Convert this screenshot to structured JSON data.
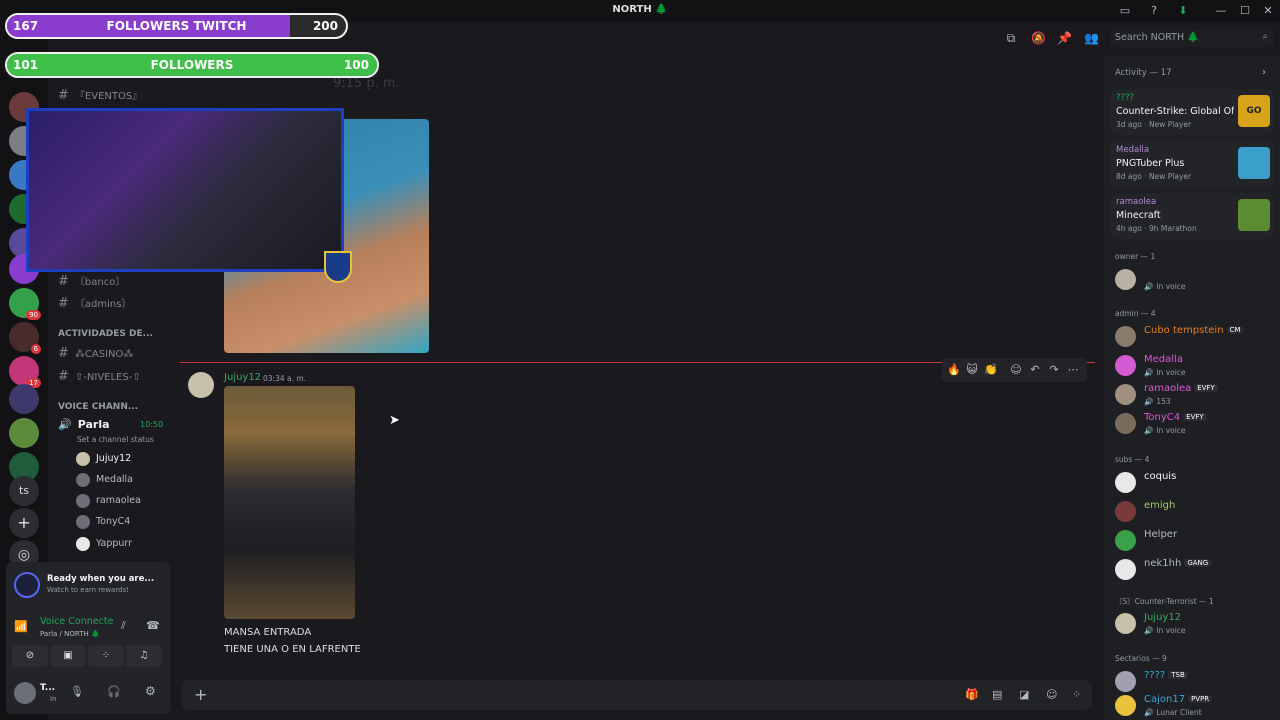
{
  "window": {
    "title": "NORTH 🌲",
    "buttons": [
      "▭",
      "?",
      "⬇",
      "—",
      "☐",
      "✕"
    ]
  },
  "overlay": {
    "twitch_bar": {
      "current": "167",
      "label": "FOLLOWERS TWITCH",
      "goal": "200",
      "progress": 0.835,
      "color": "#8a3ccf"
    },
    "followers_bar": {
      "current": "101",
      "label": "FOLLOWERS",
      "goal": "100",
      "progress": 1.0,
      "color": "#3fbf4a"
    }
  },
  "guilds": {
    "badges": [
      "90",
      "6",
      "17"
    ],
    "labels": [
      "ts"
    ],
    "add_label": "+",
    "discover_label": "◎"
  },
  "channels": {
    "items": [
      "『EVENTOS』",
      "〘banco〙",
      "〘admins〙",
      "⁂CASINO⁂",
      "⇧-NIVELES-⇧"
    ],
    "category_activities": "ACTIVIDADES DE...",
    "category_voice": "VOICE CHANN...",
    "voice_channel": {
      "name": "Parla",
      "time": "10:50",
      "status": "Set a channel status"
    },
    "voice_users": [
      "Jujuy12",
      "Medalla",
      "ramaolea",
      "TonyC4",
      "Yappurr"
    ]
  },
  "user_panel": {
    "promo_title": "Ready when you are...",
    "promo_sub": "Watch to earn rewards!",
    "voice_status": "Voice Connected",
    "voice_location": "Parla / NORTH 🌲",
    "username": "T...",
    "user_status": "In"
  },
  "chat": {
    "message": {
      "author": "Jujuy12",
      "timestamp": "03:34 a. m.",
      "lines": [
        "MANSA ENTRADA",
        "TIENE UNA O EN LAFRENTE"
      ]
    },
    "blurred_top": "9:15 p. m."
  },
  "header": {
    "search_placeholder": "Search NORTH 🌲"
  },
  "activity": {
    "title": "Activity — 17",
    "cards": [
      {
        "user": "????",
        "game": "Counter-Strike: Global Off...",
        "meta": "3d ago  ·  New Player",
        "user_color": "#23a559",
        "art_color": "#d9a21b",
        "art_text": "GO"
      },
      {
        "user": "Medalla",
        "game": "PNGTuber Plus",
        "meta": "8d ago  ·  New Player",
        "user_color": "#b48ad6",
        "art_color": "#3aa0c9",
        "art_text": ""
      },
      {
        "user": "ramaolea",
        "game": "Minecraft",
        "meta": "4h ago  ·  9h Marathon",
        "user_color": "#b48ad6",
        "art_color": "#5b8c32",
        "art_text": ""
      }
    ]
  },
  "members": {
    "sections": [
      {
        "title": "owner — 1",
        "members": [
          {
            "name": "",
            "status": "In voice",
            "color": "#c23b3b",
            "tag": ""
          }
        ]
      },
      {
        "title": "admin — 4",
        "members": [
          {
            "name": "Cubo tempstein",
            "status": "",
            "color": "#e67e22",
            "tag": "CM"
          },
          {
            "name": "Medalla",
            "status": "In voice",
            "color": "#e056d7",
            "tag": ""
          },
          {
            "name": "ramaolea",
            "status": "153",
            "color": "#e056d7",
            "tag": "EVFY"
          },
          {
            "name": "TonyC4",
            "status": "In voice",
            "color": "#e056d7",
            "tag": "EVFY"
          }
        ]
      },
      {
        "title": "subs — 4",
        "members": [
          {
            "name": "coquis",
            "status": "",
            "color": "#f2f3f5",
            "tag": ""
          },
          {
            "name": "emigh",
            "status": "",
            "color": "#9ccf6a",
            "tag": ""
          },
          {
            "name": "Helper",
            "status": "",
            "color": "#b5bac1",
            "tag": ""
          },
          {
            "name": "nek1hh",
            "status": "",
            "color": "#b5bac1",
            "tag": "GANG"
          }
        ]
      },
      {
        "title": "〘S〙Counter-Terrorist — 1",
        "members": [
          {
            "name": "Jujuy12",
            "status": "In voice",
            "color": "#3ba55d",
            "tag": ""
          }
        ]
      },
      {
        "title": "Sectarios — 9",
        "members": [
          {
            "name": "????",
            "status": "",
            "color": "#3ba5d9",
            "tag": "TSB"
          },
          {
            "name": "Cajon17",
            "status": "Lunar Client",
            "color": "#3ba5d9",
            "tag": "PVPR"
          }
        ]
      }
    ]
  },
  "colors": {
    "bg": "#1a1a1e",
    "sidebar": "#121214",
    "accent": "#5865f2",
    "green": "#23a559"
  }
}
